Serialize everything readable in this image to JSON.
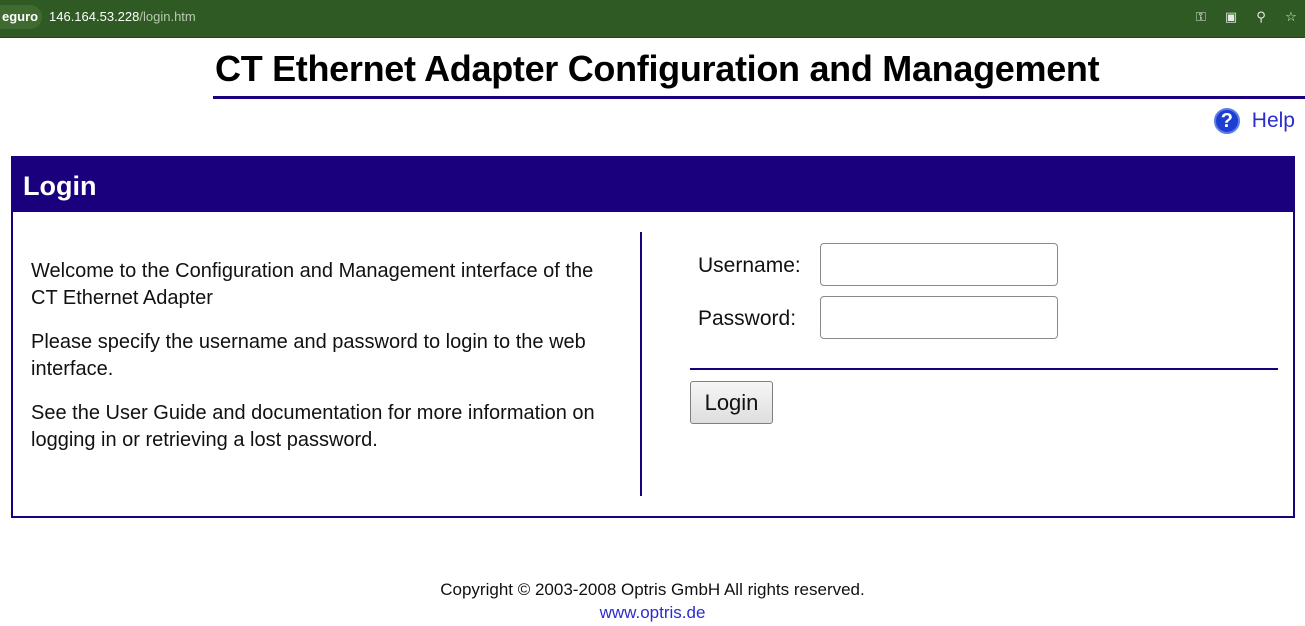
{
  "browser": {
    "secure_label": "eguro",
    "url_host": "146.164.53.228",
    "url_path": "/login.htm",
    "icons": [
      "key-icon",
      "translate-icon",
      "zoom-icon",
      "bookmark-star-icon"
    ]
  },
  "header": {
    "title": "CT Ethernet Adapter Configuration and Management",
    "help_label": "Help",
    "help_icon": "question-icon"
  },
  "panel": {
    "title": "Login",
    "intro": [
      "Welcome to the Configuration and Management interface of the CT Ethernet Adapter",
      "Please specify the username and password to login to the web interface.",
      "See the User Guide and documentation for more information on logging in or retrieving a lost password."
    ],
    "form": {
      "username_label": "Username:",
      "username_value": "",
      "password_label": "Password:",
      "password_value": "",
      "login_button": "Login"
    }
  },
  "footer": {
    "copyright": "Copyright © 2003-2008 Optris GmbH All rights reserved.",
    "link": "www.optris.de"
  },
  "colors": {
    "brand": "#1b007e",
    "link": "#2b2bcf",
    "browser_bar": "#2f5a23"
  }
}
